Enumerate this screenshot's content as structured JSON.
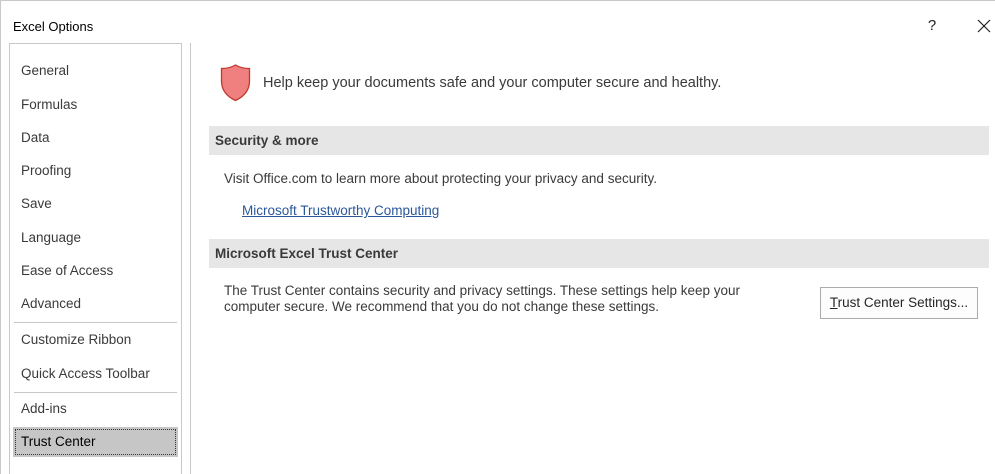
{
  "window": {
    "title": "Excel Options",
    "help_label": "?",
    "close_label": "Close"
  },
  "sidebar": {
    "items": [
      {
        "label": "General"
      },
      {
        "label": "Formulas"
      },
      {
        "label": "Data"
      },
      {
        "label": "Proofing"
      },
      {
        "label": "Save"
      },
      {
        "label": "Language"
      },
      {
        "label": "Ease of Access"
      },
      {
        "label": "Advanced"
      },
      {
        "label": "Customize Ribbon"
      },
      {
        "label": "Quick Access Toolbar"
      },
      {
        "label": "Add-ins"
      },
      {
        "label": "Trust Center"
      }
    ],
    "selected": "Trust Center"
  },
  "main": {
    "intro": "Help keep your documents safe and your computer secure and healthy.",
    "security_section": {
      "header": "Security & more",
      "text": "Visit Office.com to learn more about protecting your privacy and security.",
      "link": "Microsoft Trustworthy Computing"
    },
    "trust_section": {
      "header": "Microsoft Excel Trust Center",
      "text_line1": "The Trust Center contains security and privacy settings. These settings help keep your",
      "text_line2": "computer secure. We recommend that you do not change these settings.",
      "button_accel": "T",
      "button_rest": "rust Center Settings..."
    }
  },
  "colors": {
    "shield": "#f08080",
    "link": "#2b579a",
    "selected_bg": "#c6c6c6",
    "section_bg": "#e6e6e6"
  }
}
